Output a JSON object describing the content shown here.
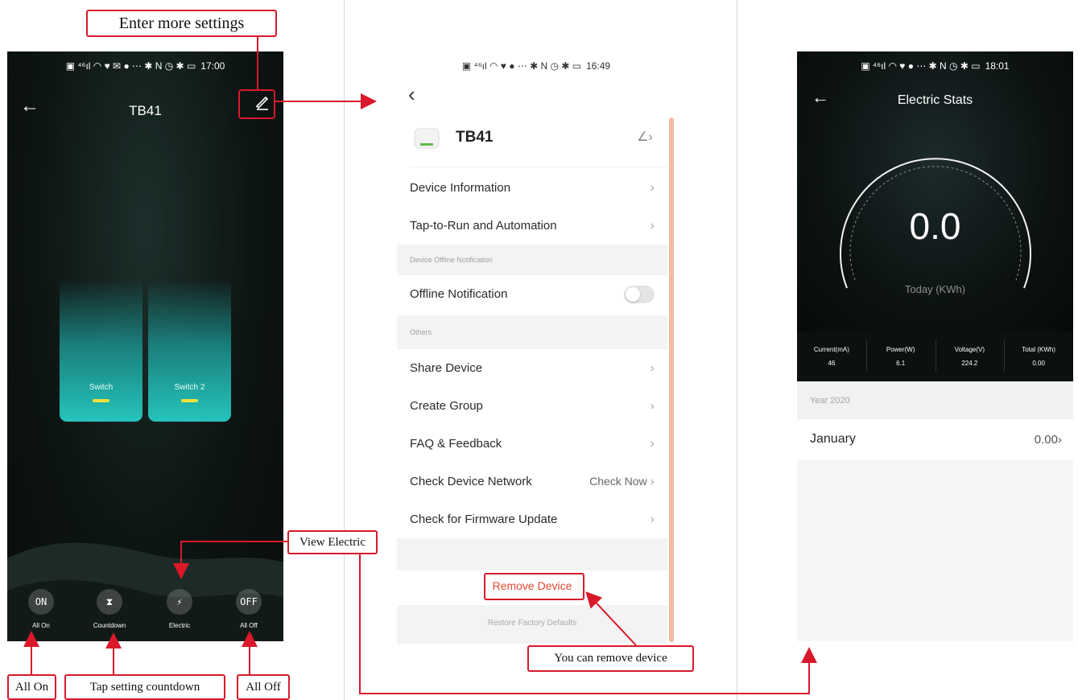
{
  "callouts": {
    "more_settings": "Enter more settings",
    "view_electric": "View Electric",
    "all_on": "All On",
    "tap_countdown": "Tap setting countdown",
    "all_off": "All Off",
    "remove_device": "You can remove device"
  },
  "screen1": {
    "status_time": "17:00",
    "title": "TB41",
    "switches": [
      {
        "label": "Switch"
      },
      {
        "label": "Switch 2"
      }
    ],
    "bottom_bar": [
      {
        "icon_text": "ON",
        "icon": "on-icon",
        "label": "All On"
      },
      {
        "icon_text": "⧗",
        "icon": "hourglass-icon",
        "label": "Countdown"
      },
      {
        "icon_text": "⚡",
        "icon": "electric-icon",
        "label": "Electric"
      },
      {
        "icon_text": "OFF",
        "icon": "off-icon",
        "label": "All Off"
      }
    ]
  },
  "screen2": {
    "status_time": "16:49",
    "device_name": "TB41",
    "rows": {
      "device_information": "Device Information",
      "tap_to_run": "Tap-to-Run and Automation",
      "offline_section": "Device Offline Notification",
      "offline_notification": "Offline Notification",
      "others_section": "Others",
      "share_device": "Share Device",
      "create_group": "Create Group",
      "faq": "FAQ & Feedback",
      "check_network": "Check Device Network",
      "check_now": "Check Now",
      "firmware": "Check for Firmware Update"
    },
    "remove_device": "Remove Device",
    "restore_defaults": "Restore Factory Defaults",
    "offline_toggle_on": false
  },
  "screen3": {
    "status_time": "18:01",
    "title": "Electric Stats",
    "big_value": "0.0",
    "big_unit": "Today (KWh)",
    "stats": [
      {
        "label": "Current(mA)",
        "value": "46"
      },
      {
        "label": "Power(W)",
        "value": "6.1"
      },
      {
        "label": "Voltage(V)",
        "value": "224.2"
      },
      {
        "label": "Total (KWh)",
        "value": "0.00"
      }
    ],
    "year": "Year 2020",
    "month": "January",
    "month_value": "0.00"
  },
  "colors": {
    "callout_red": "#d9192a",
    "teal": "#25c4bc",
    "remove_red": "#e0472f"
  }
}
